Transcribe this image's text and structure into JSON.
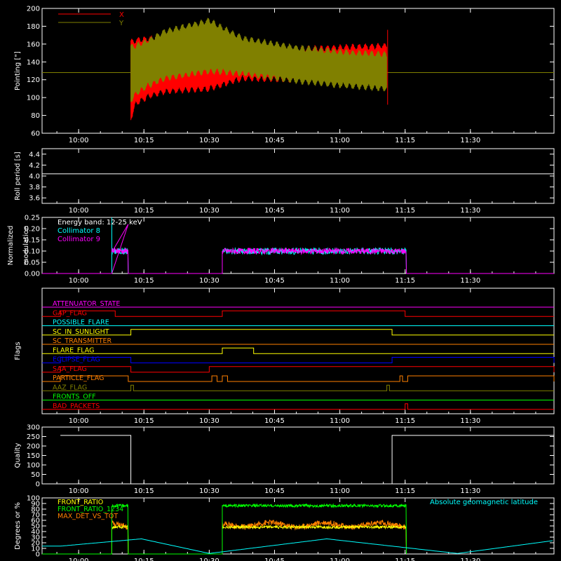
{
  "chart_data": [
    {
      "type": "line",
      "ylabel": "Pointing [\"]",
      "ylim": [
        60,
        200
      ],
      "yticks": [
        60,
        80,
        100,
        120,
        140,
        160,
        180,
        200
      ],
      "xticks": [
        "10:00",
        "10:15",
        "10:30",
        "10:45",
        "11:00",
        "11:15",
        "11:30"
      ],
      "legend": "top-left",
      "series": [
        {
          "name": "X",
          "color": "#ff0000",
          "envelope_x": [
            10.2,
            10.22,
            10.27,
            10.33,
            10.5,
            10.63,
            10.83,
            11.0,
            11.18
          ],
          "upper": [
            164,
            166,
            168,
            170,
            167,
            158,
            156,
            158,
            160
          ],
          "lower": [
            75,
            92,
            100,
            105,
            108,
            120,
            118,
            115,
            110
          ]
        },
        {
          "name": "Y",
          "color": "#808000",
          "envelope_x": [
            10.2,
            10.22,
            10.27,
            10.33,
            10.5,
            10.63,
            10.83,
            11.0,
            11.18
          ],
          "upper": [
            158,
            160,
            166,
            176,
            188,
            168,
            158,
            153,
            150
          ],
          "lower": [
            95,
            103,
            112,
            120,
            128,
            125,
            117,
            112,
            108
          ]
        }
      ],
      "reference_line": 128
    },
    {
      "type": "line",
      "ylabel": "Roll period [s]",
      "ylim": [
        3.5,
        4.5
      ],
      "yticks": [
        "3.6",
        "3.8",
        "4.0",
        "4.2",
        "4.4"
      ],
      "xticks": [
        "10:00",
        "10:15",
        "10:30",
        "10:45",
        "11:00",
        "11:15",
        "11:30"
      ],
      "series": [
        {
          "name": "",
          "color": "#ffffff",
          "x": [
            9.93,
            10.6
          ],
          "y": [
            4.04,
            4.04
          ]
        }
      ]
    },
    {
      "type": "line",
      "ylabel": "Normalized modulation",
      "ylim": [
        0,
        0.25
      ],
      "yticks": [
        "0.00",
        "0.05",
        "0.10",
        "0.15",
        "0.20",
        "0.25"
      ],
      "xticks": [
        "10:00",
        "10:15",
        "10:30",
        "10:45",
        "11:00",
        "11:15",
        "11:30"
      ],
      "annotation": "Energy band: 12-25 keV",
      "series": [
        {
          "name": "Collimator 8",
          "color": "#00ffff",
          "segments": [
            [
              10.127,
              10.19
            ],
            [
              10.55,
              11.255
            ]
          ],
          "level": 0.1,
          "noise": 0.015
        },
        {
          "name": "Collimator 9",
          "color": "#ff00ff",
          "segments": [
            [
              10.127,
              10.19
            ],
            [
              10.55,
              11.255
            ]
          ],
          "level": 0.1,
          "noise": 0.013
        }
      ]
    },
    {
      "type": "line",
      "ylabel": "Flags",
      "xticks": [
        "10:00",
        "10:15",
        "10:30",
        "10:45",
        "11:00",
        "11:15",
        "11:30"
      ],
      "flags": [
        {
          "name": "ATTENUATOR_STATE",
          "color": "#ff00ff",
          "highs": []
        },
        {
          "name": "GAP_FLAG",
          "color": "#ff0000",
          "highs": [
            [
              9.93,
              10.14
            ],
            [
              10.55,
              11.25
            ]
          ],
          "dip": true
        },
        {
          "name": "POSSIBLE_FLARE",
          "color": "#00ffff",
          "highs": []
        },
        {
          "name": "SC_IN_SUNLIGHT",
          "color": "#ffff00",
          "highs": [
            [
              10.2,
              11.2
            ]
          ]
        },
        {
          "name": "SC_TRANSMITTER",
          "color": "#ff8000",
          "highs": []
        },
        {
          "name": "FLARE_FLAG",
          "color": "#ffff00",
          "highs": [
            [
              10.55,
              10.67
            ]
          ]
        },
        {
          "name": "ECLIPSE_FLAG",
          "color": "#0000ff",
          "highs": [
            [
              9.93,
              10.2
            ],
            [
              11.2,
              11.82
            ]
          ]
        },
        {
          "name": "SAA_FLAG",
          "color": "#ff0000",
          "highs": [
            [
              9.93,
              10.2
            ],
            [
              10.5,
              11.82
            ]
          ]
        },
        {
          "name": "PARTICLE_FLAG",
          "color": "#ff8000",
          "highs": [
            [
              9.93,
              10.19
            ],
            [
              10.51,
              10.53
            ],
            [
              10.55,
              10.57
            ],
            [
              11.23,
              11.24
            ],
            [
              11.26,
              11.82
            ]
          ]
        },
        {
          "name": "AAZ_FLAG",
          "color": "#808000",
          "highs": [
            [
              10.2,
              10.21
            ],
            [
              11.18,
              11.19
            ]
          ]
        },
        {
          "name": "FRONTS_OFF",
          "color": "#00ff00",
          "highs": []
        },
        {
          "name": "BAD_PACKETS",
          "color": "#ff0000",
          "highs": [
            [
              11.25,
              11.26
            ]
          ]
        }
      ]
    },
    {
      "type": "line",
      "ylabel": "Quality",
      "ylim": [
        0,
        300
      ],
      "yticks": [
        0,
        50,
        100,
        150,
        200,
        250,
        300
      ],
      "xticks": [
        "10:00",
        "10:15",
        "10:30",
        "10:45",
        "11:00",
        "11:15",
        "11:30"
      ],
      "series": [
        {
          "name": "",
          "color": "#ffffff",
          "x": [
            9.93,
            10.2,
            10.2,
            10.2,
            11.2,
            11.2,
            11.82
          ],
          "y": [
            256,
            256,
            40,
            0,
            0,
            256,
            256
          ]
        }
      ]
    },
    {
      "type": "line",
      "ylabel": "Degrees or %",
      "ylim": [
        0,
        100
      ],
      "yticks": [
        0,
        10,
        20,
        30,
        40,
        50,
        60,
        70,
        80,
        90,
        100
      ],
      "xticks": [
        "10:00",
        "10:15",
        "10:30",
        "10:45",
        "11:00",
        "11:15",
        "11:30"
      ],
      "series": [
        {
          "name": "FRONT_RATIO",
          "color": "#ffff00",
          "segments": [
            [
              10.127,
              10.19
            ],
            [
              10.55,
              11.255
            ]
          ],
          "level": 48
        },
        {
          "name": "FRONT_RATIO_1234",
          "color": "#00ff00",
          "segments": [
            [
              10.127,
              10.19
            ],
            [
              10.55,
              11.255
            ]
          ],
          "level": 86
        },
        {
          "name": "MAX_DET_VS_TOT",
          "color": "#ff8000",
          "segments": [
            [
              10.127,
              10.19
            ],
            [
              10.55,
              11.255
            ]
          ],
          "level": 52
        },
        {
          "name": "Absolute geomagnetic latitude",
          "color": "#00ffff",
          "x": [
            9.93,
            10.24,
            10.5,
            10.95,
            11.45,
            11.82
          ],
          "y": [
            14,
            27,
            1,
            27,
            1,
            24
          ]
        }
      ]
    }
  ]
}
